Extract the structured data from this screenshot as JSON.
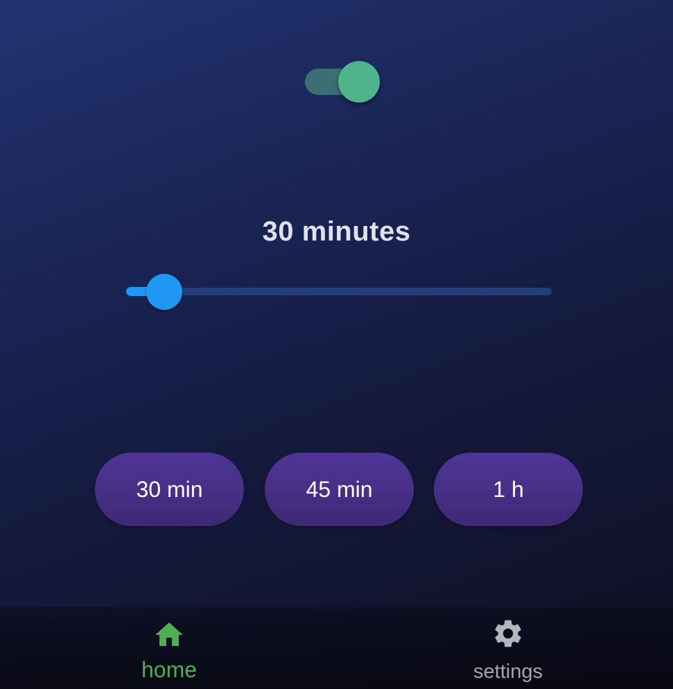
{
  "toggle": {
    "state": "on",
    "track_color": "#3b6f74",
    "thumb_color": "#4fb48c"
  },
  "duration": {
    "label": "30 minutes",
    "slider_fraction": 0.09,
    "accent_color": "#2196f3"
  },
  "presets": [
    {
      "label": "30 min"
    },
    {
      "label": "45 min"
    },
    {
      "label": "1 h"
    }
  ],
  "preset_color": "#4a318c",
  "bottom_nav": {
    "items": [
      {
        "label": "home",
        "icon": "home-icon",
        "active": true,
        "color": "#4caf50"
      },
      {
        "label": "settings",
        "icon": "gear-icon",
        "active": false,
        "color": "#a4a6ae"
      }
    ]
  }
}
